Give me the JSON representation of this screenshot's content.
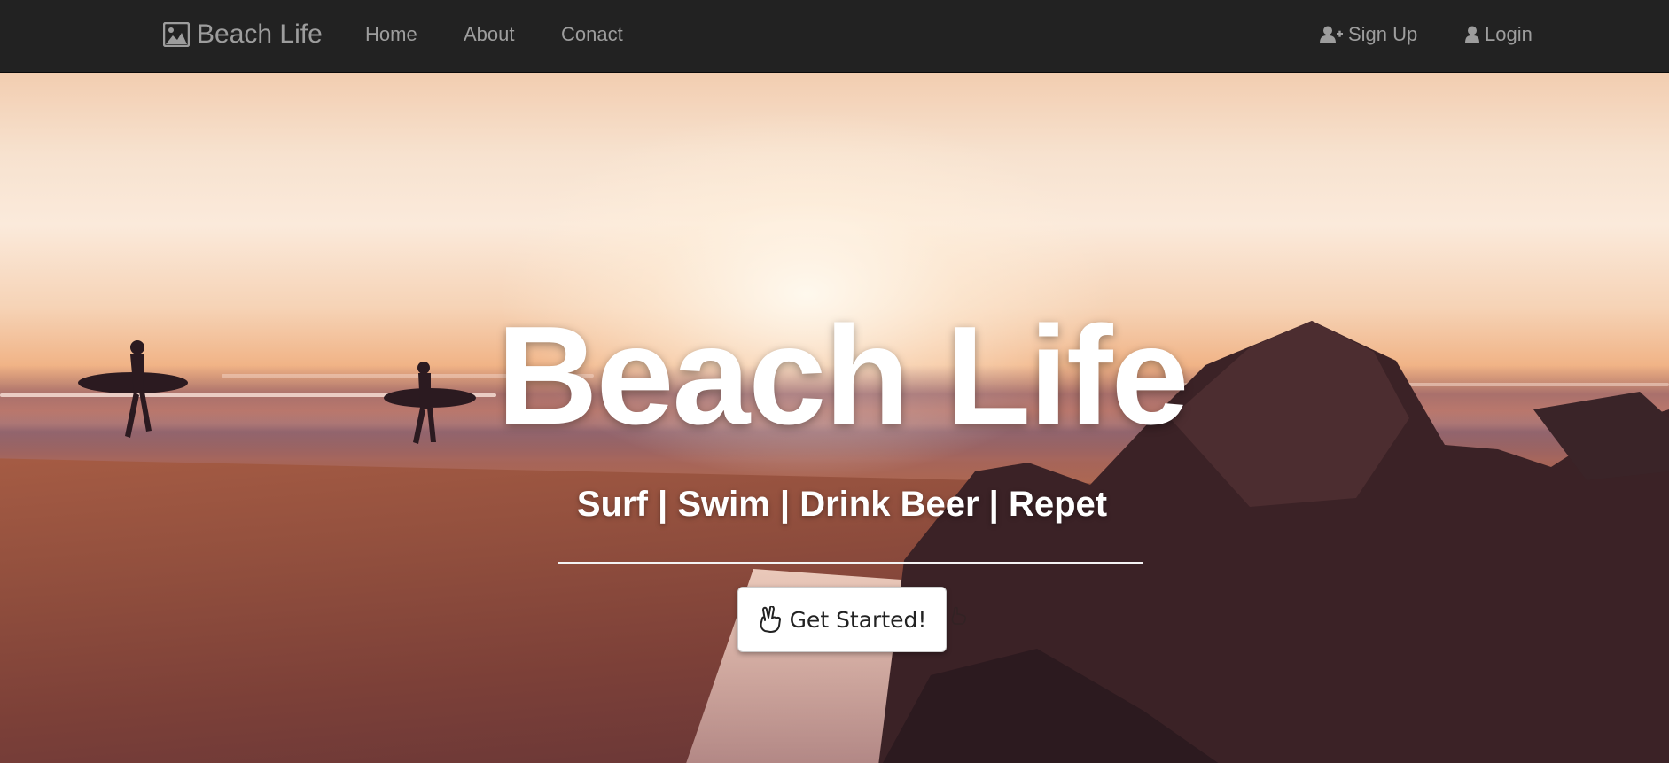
{
  "navbar": {
    "brand": {
      "label": "Beach Life",
      "icon": "picture-icon"
    },
    "links": [
      {
        "label": "Home"
      },
      {
        "label": "About"
      },
      {
        "label": "Conact"
      }
    ],
    "right_links": [
      {
        "label": "Sign Up",
        "icon": "user-plus-icon"
      },
      {
        "label": "Login",
        "icon": "user-icon"
      }
    ]
  },
  "hero": {
    "title": "Beach Life",
    "subtitle": "Surf | Swim | Drink Beer | Repet",
    "cta": {
      "label": "Get Started!",
      "icon": "hand-peace-icon"
    }
  },
  "colors": {
    "navbar_bg": "#222222",
    "nav_text": "#9d9d9d",
    "hero_text": "#ffffff",
    "button_bg": "#ffffff"
  }
}
